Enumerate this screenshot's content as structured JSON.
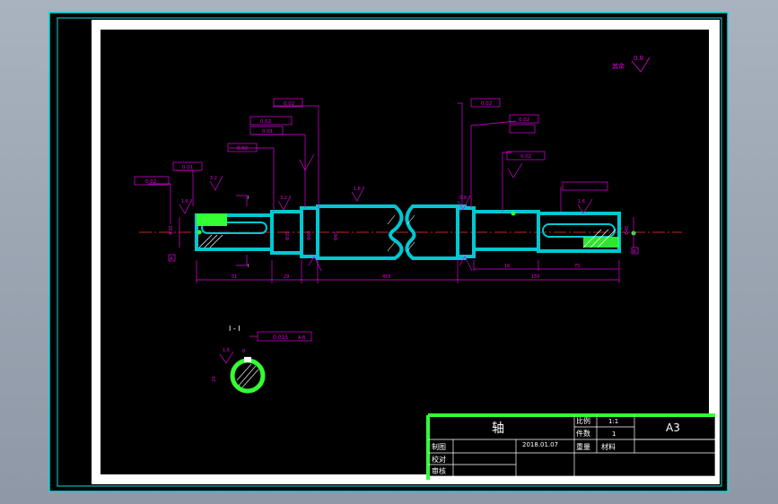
{
  "colors": {
    "background": "#000000",
    "frame": "#00e0e0",
    "paper_margin": "#ffffff",
    "shaft": "#00c8d2",
    "dimension": "#e000e0",
    "highlight": "#33ff33",
    "hatch": "#ffffff",
    "title_text": "#ffffff"
  },
  "roughness": {
    "note": "其余",
    "value": "0.8"
  },
  "shaft_labels": {
    "section_mark_left": "I",
    "section_mark_left_bottom": "I",
    "tol_1": "0.02",
    "tol_2a": "0.01",
    "tol_2b": "0.01",
    "tol_3": "0.02",
    "tol_4": "0.02",
    "tol_5": "0.02",
    "tol_6": "0.02",
    "tol_7": "0.02",
    "tol_8": "0.02",
    "rough_1": "1.6",
    "rough_2": "3.2",
    "rough_3": "3.2",
    "rough_4": "1.6",
    "rough_5": "0.8",
    "rough_6": "1.6",
    "dim_1": "Φ30",
    "dim_2": "Φ35",
    "dim_3": "Φ40",
    "dim_4": "Φ45",
    "dim_5": "Φ40",
    "len_1": "51",
    "len_2": "29",
    "len_3": "16",
    "len_4": "150",
    "len_5": "75",
    "len_total": "455",
    "datum_a": "A",
    "datum_b": "B"
  },
  "section": {
    "title": "I - I",
    "tolerance": "0.015",
    "datum": "A-B",
    "rough": "1.6",
    "dim_left": "24",
    "dim_right": "8"
  },
  "title_block": {
    "part_name": "轴",
    "scale_label": "比例",
    "scale_value": "1:1",
    "count_label": "件数",
    "count_value": "1",
    "paper_size": "A3",
    "drawn_label": "制图",
    "date": "2018.01.07",
    "weight_label": "重量",
    "material_label": "材料",
    "check_label": "校对",
    "review_label": "审核"
  }
}
